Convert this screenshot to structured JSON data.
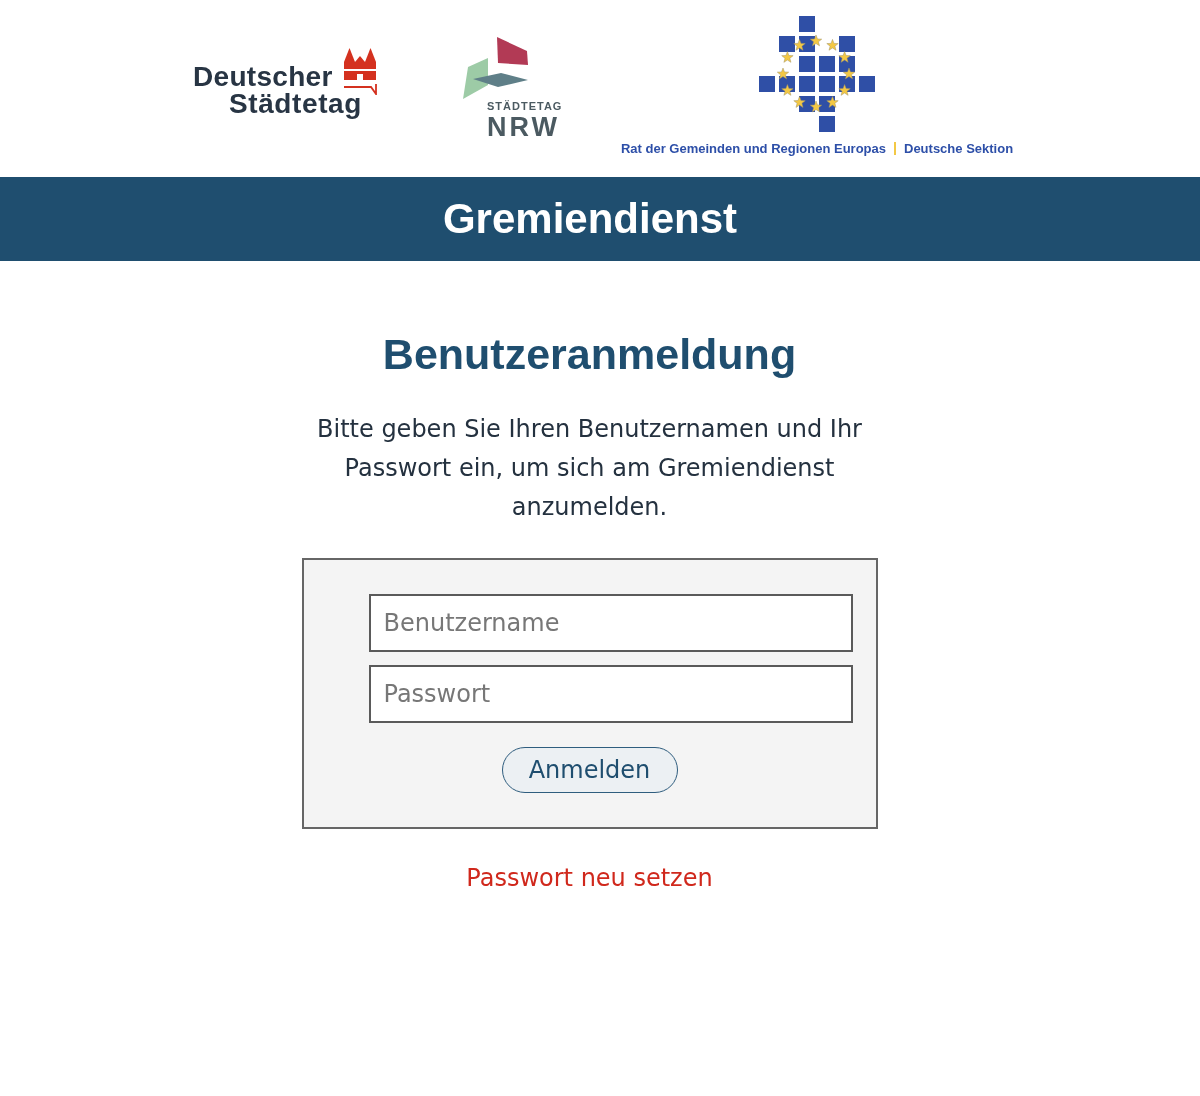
{
  "logos": [
    {
      "kind": "staedtetag",
      "lines": [
        "Deutscher",
        "Städtetag"
      ]
    },
    {
      "kind": "nrw",
      "small": "STÄDTETAG",
      "large": "NRW"
    },
    {
      "kind": "rgre",
      "caption": [
        "Rat der Gemeinden und Regionen Europas",
        "Deutsche Sektion"
      ]
    }
  ],
  "banner": {
    "title": "Gremiendienst"
  },
  "login": {
    "heading": "Benutzeranmeldung",
    "intro": "Bitte geben Sie Ihren Benutzernamen und Ihr Passwort ein, um sich am Gremiendienst anzumelden.",
    "fields": [
      {
        "placeholder": "Benutzername"
      },
      {
        "placeholder": "Passwort"
      }
    ],
    "submit": "Anmelden"
  },
  "reset_link": "Passwort neu setzen"
}
